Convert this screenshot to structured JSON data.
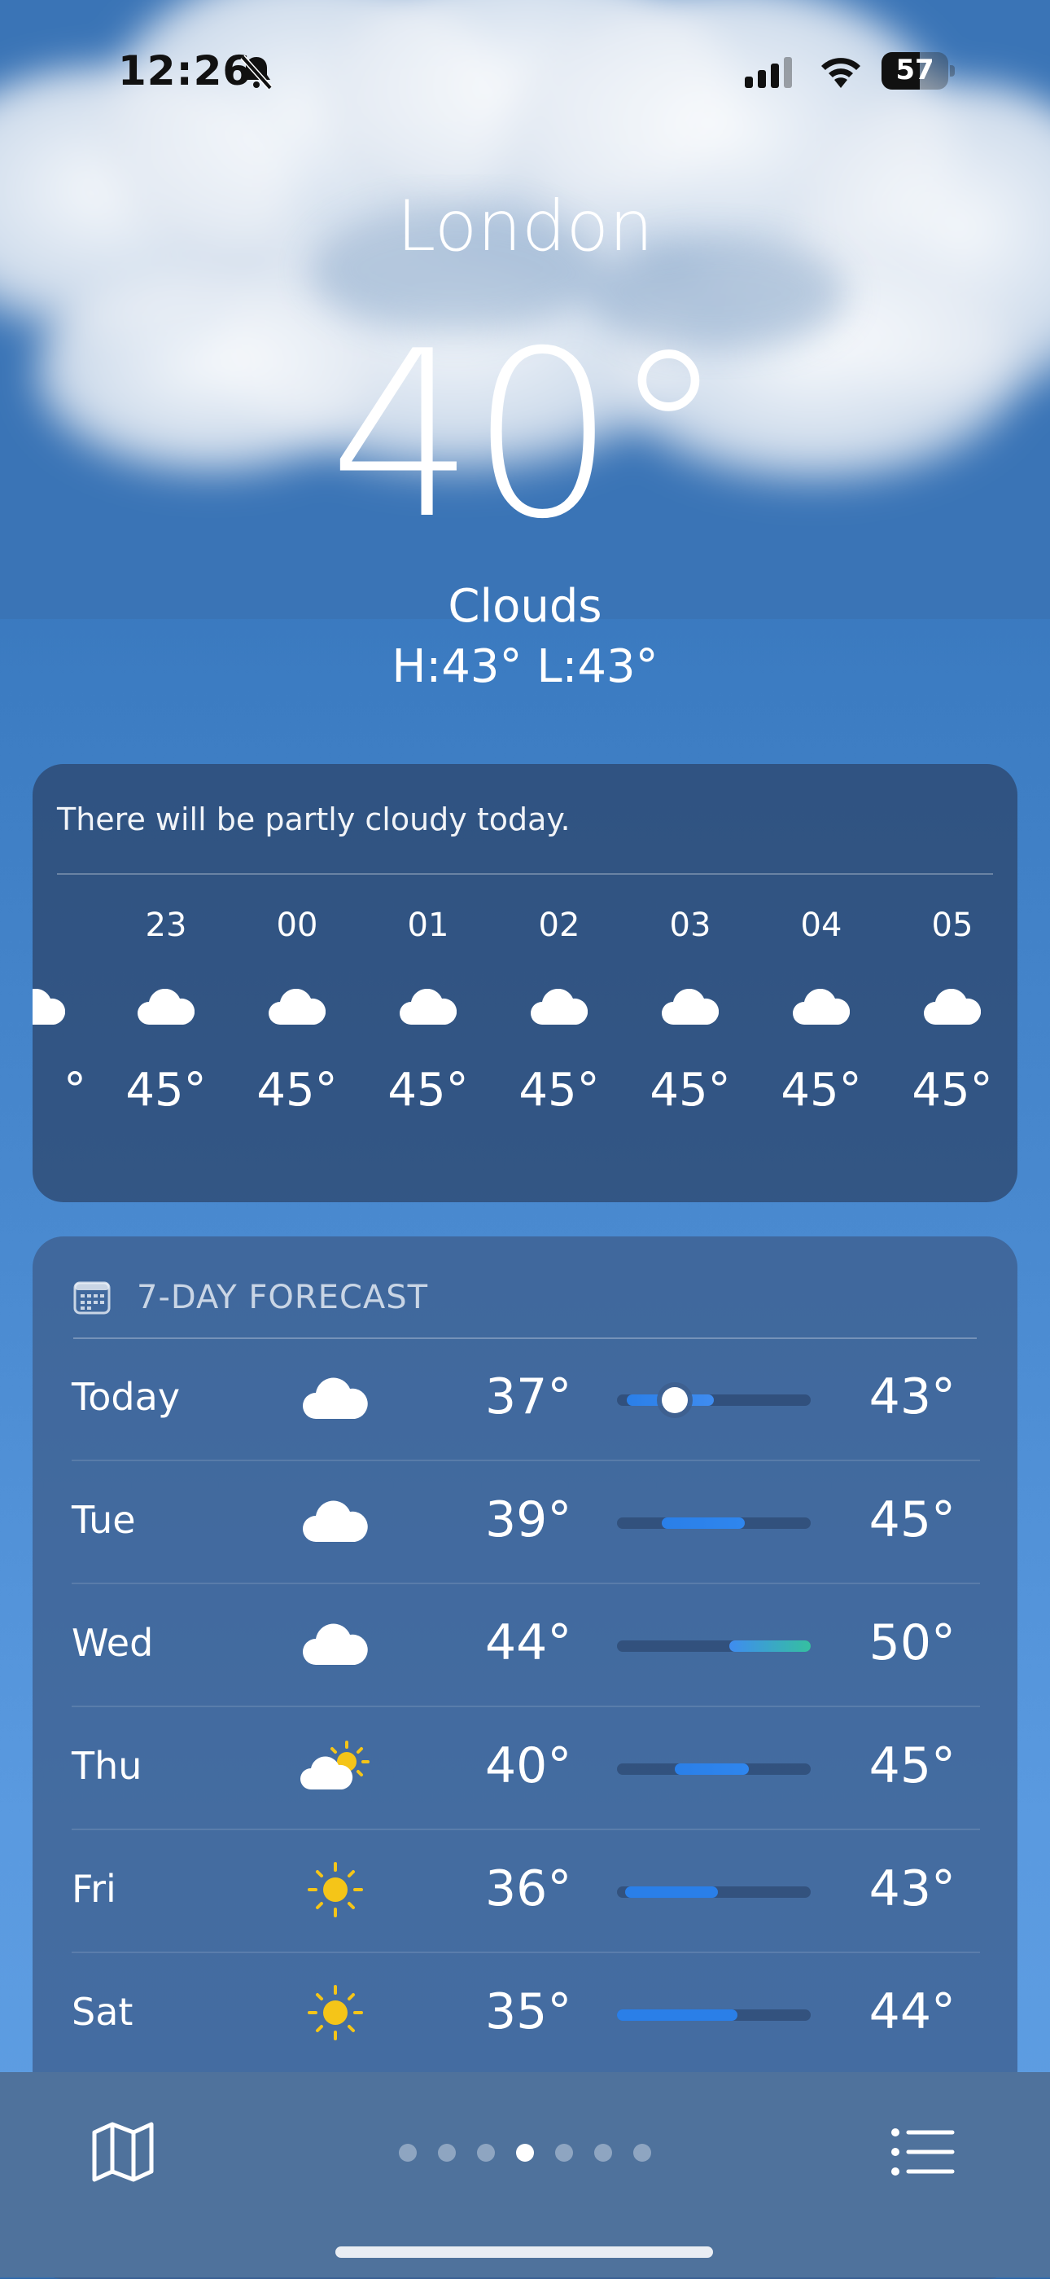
{
  "status_bar": {
    "time": "12:26",
    "battery": "57"
  },
  "location": {
    "city": "London",
    "temperature": "40°",
    "condition": "Clouds",
    "high_low": "H:43° L:43°"
  },
  "hourly": {
    "summary": "There will be partly cloudy today.",
    "partial_temp": "°",
    "hours": [
      {
        "time": "23",
        "icon": "cloud-icon",
        "temp": "45°"
      },
      {
        "time": "00",
        "icon": "cloud-icon",
        "temp": "45°"
      },
      {
        "time": "01",
        "icon": "cloud-icon",
        "temp": "45°"
      },
      {
        "time": "02",
        "icon": "cloud-icon",
        "temp": "45°"
      },
      {
        "time": "03",
        "icon": "cloud-icon",
        "temp": "45°"
      },
      {
        "time": "04",
        "icon": "cloud-icon",
        "temp": "45°"
      },
      {
        "time": "05",
        "icon": "cloud-icon",
        "temp": "45°"
      }
    ]
  },
  "forecast": {
    "title": "7-DAY FORECAST",
    "days": [
      {
        "day": "Today",
        "icon": "cloud-icon",
        "low": "37°",
        "high": "43°",
        "range_start": 0.05,
        "range_end": 0.5,
        "current": 0.3,
        "color": "#3f8cf0"
      },
      {
        "day": "Tue",
        "icon": "cloud-icon",
        "low": "39°",
        "high": "45°",
        "range_start": 0.23,
        "range_end": 0.66,
        "color": "#2f86ee"
      },
      {
        "day": "Wed",
        "icon": "cloud-icon",
        "low": "44°",
        "high": "50°",
        "range_start": 0.58,
        "range_end": 1.0,
        "color": "#35c0a0"
      },
      {
        "day": "Thu",
        "icon": "partly-sunny-icon",
        "low": "40°",
        "high": "45°",
        "range_start": 0.3,
        "range_end": 0.68,
        "color": "#2f86ee"
      },
      {
        "day": "Fri",
        "icon": "sun-icon",
        "low": "36°",
        "high": "43°",
        "range_start": 0.04,
        "range_end": 0.52,
        "color": "#2a7fe8"
      },
      {
        "day": "Sat",
        "icon": "sun-icon",
        "low": "35°",
        "high": "44°",
        "range_start": 0.0,
        "range_end": 0.62,
        "color": "#2a7fe8"
      }
    ]
  },
  "pager": {
    "count": 7,
    "active_index": 3
  },
  "colors": {
    "sun": "#f5c518",
    "cloud": "#ffffff",
    "accent_blue": "#3f8cf0",
    "accent_green": "#35c0a0"
  }
}
